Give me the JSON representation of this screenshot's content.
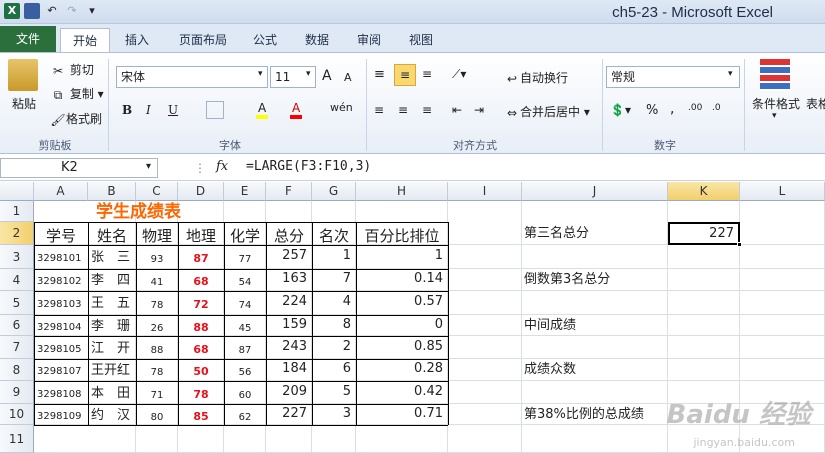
{
  "titlebar": {
    "title": "ch5-23 - Microsoft Excel",
    "app_icon": "X"
  },
  "tabs": [
    "文件",
    "开始",
    "插入",
    "页面布局",
    "公式",
    "数据",
    "审阅",
    "视图"
  ],
  "ribbon": {
    "clipboard": {
      "paste": "粘贴",
      "cut": "剪切",
      "copy": "复制",
      "format_painter": "格式刷",
      "group": "剪贴板"
    },
    "font": {
      "name": "宋体",
      "size": "11",
      "grow": "A",
      "shrink": "A",
      "bold": "B",
      "italic": "I",
      "underline": "U",
      "fill": "A",
      "color": "A",
      "phonetic": "wén",
      "group": "字体"
    },
    "alignment": {
      "wrap": "自动换行",
      "merge": "合并后居中",
      "group": "对齐方式"
    },
    "number": {
      "format": "常规",
      "percent": "%",
      "comma": ",",
      "group": "数字"
    },
    "styles": {
      "conditional": "条件格式",
      "table": "表格"
    }
  },
  "formula_bar": {
    "name_box": "K2",
    "fx": "fx",
    "formula": "=LARGE(F3:F10,3)"
  },
  "columns": [
    "A",
    "B",
    "C",
    "D",
    "E",
    "F",
    "G",
    "H",
    "I",
    "J",
    "K",
    "L"
  ],
  "rows": [
    "1",
    "2",
    "3",
    "4",
    "5",
    "6",
    "7",
    "8",
    "9",
    "10",
    "11"
  ],
  "sheet": {
    "title": "学生成绩表",
    "headers": [
      "学号",
      "姓名",
      "物理",
      "地理",
      "化学",
      "总分",
      "名次",
      "百分比排位"
    ],
    "data": [
      [
        "3298101",
        "张　三",
        "93",
        "87",
        "77",
        "257",
        "1",
        "1"
      ],
      [
        "3298102",
        "李　四",
        "41",
        "68",
        "54",
        "163",
        "7",
        "0.14"
      ],
      [
        "3298103",
        "王　五",
        "78",
        "72",
        "74",
        "224",
        "4",
        "0.57"
      ],
      [
        "3298104",
        "李　珊",
        "26",
        "88",
        "45",
        "159",
        "8",
        "0"
      ],
      [
        "3298105",
        "江　开",
        "88",
        "68",
        "87",
        "243",
        "2",
        "0.85"
      ],
      [
        "3298107",
        "王开红",
        "78",
        "50",
        "56",
        "184",
        "6",
        "0.28"
      ],
      [
        "3298108",
        "本　田",
        "71",
        "78",
        "60",
        "209",
        "5",
        "0.42"
      ],
      [
        "3298109",
        "约　汉",
        "80",
        "85",
        "62",
        "227",
        "3",
        "0.71"
      ]
    ],
    "side_labels": [
      "第三名总分",
      "倒数第3名总分",
      "中间成绩",
      "成绩众数",
      "第38%比例的总成绩"
    ],
    "k2_value": "227"
  },
  "watermark": {
    "main": "Baidu 经验",
    "sub": "jingyan.baidu.com"
  }
}
